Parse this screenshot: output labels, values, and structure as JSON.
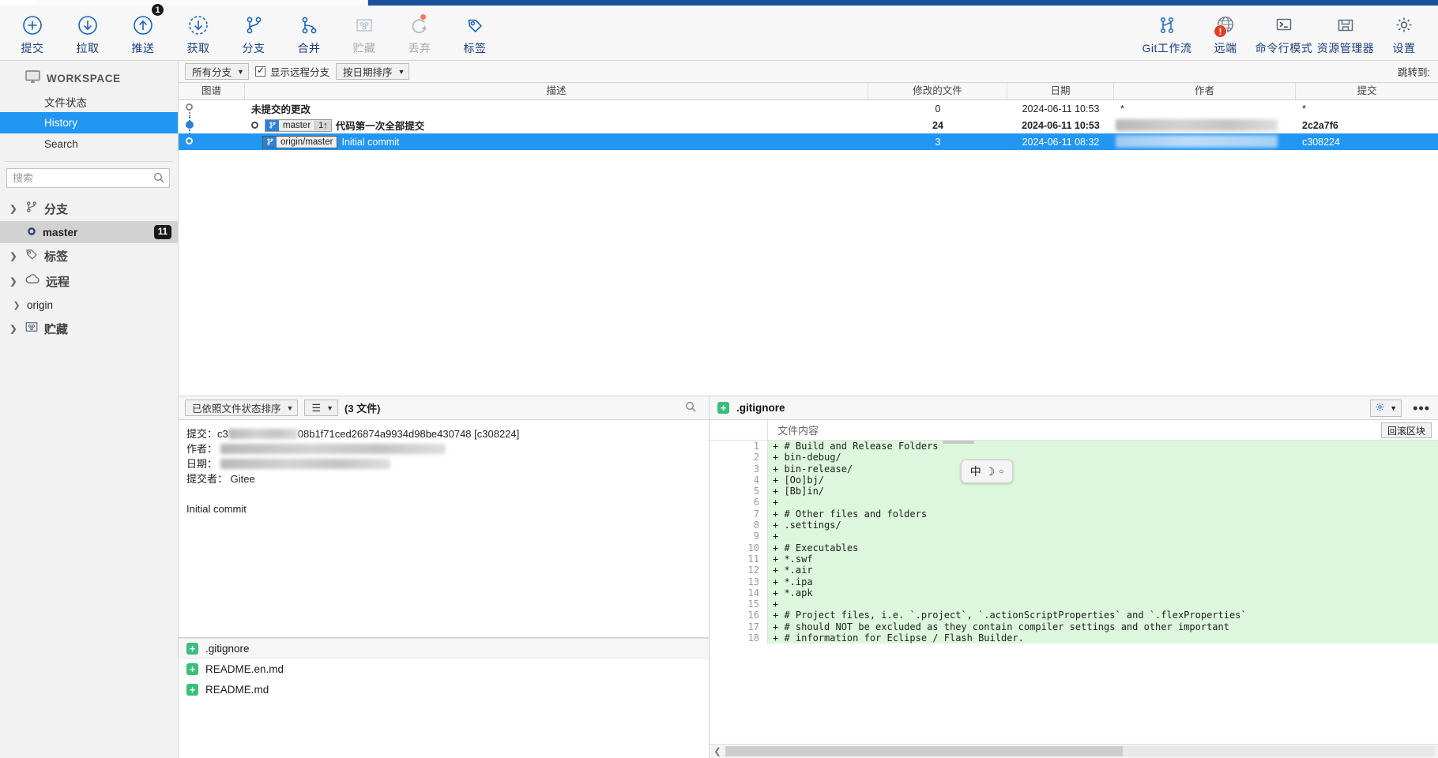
{
  "toolbar": {
    "left_buttons": [
      {
        "label": "提交",
        "icon": "plus-circle-icon",
        "disabled": false,
        "badge": null
      },
      {
        "label": "拉取",
        "icon": "arrow-down-circle-icon",
        "disabled": false,
        "badge": null
      },
      {
        "label": "推送",
        "icon": "arrow-up-circle-icon",
        "disabled": false,
        "badge": "1"
      },
      {
        "label": "获取",
        "icon": "arrow-down-dashed-circle-icon",
        "disabled": false,
        "badge": null
      },
      {
        "label": "分支",
        "icon": "branch-icon",
        "disabled": false,
        "badge": null
      },
      {
        "label": "合并",
        "icon": "merge-icon",
        "disabled": false,
        "badge": null
      },
      {
        "label": "贮藏",
        "icon": "stash-box-icon",
        "disabled": true,
        "badge": null
      },
      {
        "label": "丢弃",
        "icon": "discard-refresh-icon",
        "disabled": true,
        "badge": null
      },
      {
        "label": "标签",
        "icon": "tag-icon",
        "disabled": false,
        "badge": null
      }
    ],
    "right_buttons": [
      {
        "label": "Git工作流",
        "icon": "git-flow-icon",
        "badge": null
      },
      {
        "label": "远端",
        "icon": "globe-icon",
        "badge": "!"
      },
      {
        "label": "命令行模式",
        "icon": "terminal-icon",
        "badge": null
      },
      {
        "label": "资源管理器",
        "icon": "folder-explorer-icon",
        "badge": null
      },
      {
        "label": "设置",
        "icon": "gear-icon",
        "badge": null
      }
    ]
  },
  "sidebar": {
    "workspace_label": "WORKSPACE",
    "nav": [
      {
        "label": "文件状态",
        "active": false
      },
      {
        "label": "History",
        "active": true
      },
      {
        "label": "Search",
        "active": false
      }
    ],
    "search_placeholder": "搜索",
    "search_value": "",
    "sections": [
      {
        "label": "分支",
        "icon": "branch-icon",
        "expanded": true
      },
      {
        "label": "标签",
        "icon": "tag-icon",
        "expanded": true
      },
      {
        "label": "远程",
        "icon": "cloud-icon",
        "expanded": true
      },
      {
        "label": "贮藏",
        "icon": "stash-box-icon",
        "expanded": true
      }
    ],
    "branch_item": {
      "label": "master",
      "count": "11",
      "selected": true
    },
    "remote_item": {
      "label": "origin",
      "expanded": false
    }
  },
  "filterbar": {
    "branch_filter": "所有分支",
    "show_remote_label": "显示远程分支",
    "show_remote_checked": true,
    "sort_filter": "按日期排序",
    "jump_to_label": "跳转到:"
  },
  "graph_table": {
    "columns": [
      "图谱",
      "描述",
      "修改的文件",
      "日期",
      "作者",
      "提交"
    ],
    "rows": [
      {
        "description": "未提交的更改",
        "ref": null,
        "files": "0",
        "date": "2024-06-11 10:53",
        "author": "*",
        "commit": "*",
        "selected": false,
        "bold": true
      },
      {
        "description": "代码第一次全部提交",
        "ref": {
          "name": "master",
          "ahead": "1↑",
          "current": true
        },
        "files": "24",
        "date": "2024-06-11 10:53",
        "author": "",
        "commit": "2c2a7f6",
        "selected": false,
        "bold": true
      },
      {
        "description": "Initial commit",
        "ref": {
          "name": "origin/master",
          "ahead": null,
          "current": false
        },
        "files": "3",
        "date": "2024-06-11 08:32",
        "author": "",
        "commit": "c308224",
        "selected": true,
        "bold": false
      }
    ]
  },
  "file_panel": {
    "sort_label": "已依照文件状态排序",
    "view_icon": "list-lines-icon",
    "count_label": "(3 文件)",
    "search_icon": "search-icon",
    "detail": {
      "commit_label": "提交：",
      "commit_value": "c3                08b1f71ced26874a9934d98be430748 [c308224]",
      "author_label": "作者：",
      "author_value": "",
      "date_label": "日期：",
      "date_value": "",
      "committer_label": "提交者：",
      "committer_value": "Gitee",
      "message": "Initial commit"
    },
    "files": [
      {
        "name": ".gitignore",
        "status": "added",
        "selected": true
      },
      {
        "name": "README.en.md",
        "status": "added",
        "selected": false
      },
      {
        "name": "README.md",
        "status": "added",
        "selected": false
      }
    ]
  },
  "diff_panel": {
    "filename": ".gitignore",
    "status": "added",
    "gear_icon": "gear-icon",
    "more_icon": "ellipsis-icon",
    "content_header": "文件内容",
    "rollback_label": "回滚区块",
    "ime_indicator": "中 ☽ ○",
    "lines": [
      {
        "n": "1",
        "text": "+ # Build and Release Folders"
      },
      {
        "n": "2",
        "text": "+ bin-debug/"
      },
      {
        "n": "3",
        "text": "+ bin-release/"
      },
      {
        "n": "4",
        "text": "+ [Oo]bj/"
      },
      {
        "n": "5",
        "text": "+ [Bb]in/"
      },
      {
        "n": "6",
        "text": "+ "
      },
      {
        "n": "7",
        "text": "+ # Other files and folders"
      },
      {
        "n": "8",
        "text": "+ .settings/"
      },
      {
        "n": "9",
        "text": "+ "
      },
      {
        "n": "10",
        "text": "+ # Executables"
      },
      {
        "n": "11",
        "text": "+ *.swf"
      },
      {
        "n": "12",
        "text": "+ *.air"
      },
      {
        "n": "13",
        "text": "+ *.ipa"
      },
      {
        "n": "14",
        "text": "+ *.apk"
      },
      {
        "n": "15",
        "text": "+ "
      },
      {
        "n": "16",
        "text": "+ # Project files, i.e. `.project`, `.actionScriptProperties` and `.flexProperties`"
      },
      {
        "n": "17",
        "text": "+ # should NOT be excluded as they contain compiler settings and other important"
      },
      {
        "n": "18",
        "text": "+ # information for Eclipse / Flash Builder."
      }
    ]
  },
  "colors": {
    "accent_blue": "#1a4f9c",
    "selection_blue": "#2196f3",
    "icon_blue": "#1c63b8",
    "added_green": "#3bbd7e",
    "diff_add_bg": "#ddf7dd",
    "warn_red": "#e23b26"
  }
}
